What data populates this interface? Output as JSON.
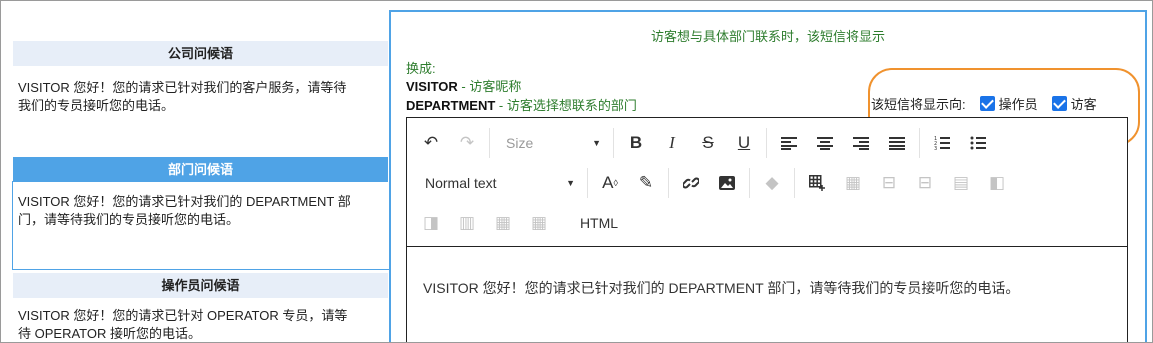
{
  "greetings": [
    {
      "title": "公司问候语",
      "text_line1": "VISITOR 您好！您的请求已针对我们的客户服务，请等待",
      "text_line2": "我们的专员接听您的电话。"
    },
    {
      "title": "部门问候语",
      "text_line1": "VISITOR 您好！您的请求已针对我们的 DEPARTMENT 部",
      "text_line2": "门，请等待我们的专员接听您的电话。"
    },
    {
      "title": "操作员问候语",
      "text_line1": "VISITOR 您好！您的请求已针对 OPERATOR 专员，请等",
      "text_line2": "待 OPERATOR 接听您的电话。"
    }
  ],
  "panel": {
    "note": "访客想与具体部门联系时，该短信将显示",
    "replace_label": "换成:",
    "vars": [
      {
        "key": "VISITOR",
        "desc": " - 访客昵称"
      },
      {
        "key": "DEPARTMENT",
        "desc": " - 访客选择想联系的部门"
      }
    ],
    "show_label": "该短信将显示向:",
    "options": [
      {
        "label": "操作员",
        "checked": true
      },
      {
        "label": "访客",
        "checked": true
      }
    ]
  },
  "toolbar": {
    "size_label": "Size",
    "format_label": "Normal text",
    "html_label": "HTML"
  },
  "editor": {
    "content": "VISITOR 您好！您的请求已针对我们的 DEPARTMENT 部门，请等待我们的专员接听您的电话。"
  },
  "colors": {
    "accent": "#4fa3e6",
    "highlight": "#f0922e",
    "green": "#2e7d2e",
    "checkbox": "#1a73e8"
  }
}
